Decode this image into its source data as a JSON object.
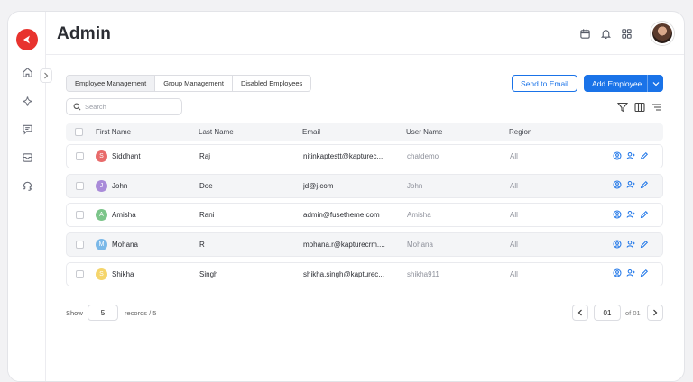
{
  "header": {
    "title": "Admin",
    "icons": [
      "calendar-icon",
      "bell-icon",
      "apps-grid-icon"
    ]
  },
  "sidebar": {
    "items": [
      {
        "name": "home",
        "icon": "home-icon"
      },
      {
        "name": "ai",
        "icon": "sparkle-icon"
      },
      {
        "name": "messages",
        "icon": "chat-icon"
      },
      {
        "name": "inbox",
        "icon": "inbox-icon"
      },
      {
        "name": "support",
        "icon": "headset-icon"
      }
    ]
  },
  "tabs": [
    {
      "label": "Employee Management",
      "active": true
    },
    {
      "label": "Group Management",
      "active": false
    },
    {
      "label": "Disabled Employees",
      "active": false
    }
  ],
  "toolbar": {
    "send_email_label": "Send to Email",
    "add_employee_label": "Add Employee",
    "search_placeholder": "Search"
  },
  "table": {
    "columns": [
      "First Name",
      "Last Name",
      "Email",
      "User Name",
      "Region"
    ],
    "rows": [
      {
        "initial": "S",
        "color": "#e86b6b",
        "first": "Siddhant",
        "last": "Raj",
        "email": "nitinkaptestt@kapturec...",
        "username": "chatdemo",
        "region": "All"
      },
      {
        "initial": "J",
        "color": "#a98bd9",
        "first": "John",
        "last": "Doe",
        "email": "jd@j.com",
        "username": "John",
        "region": "All"
      },
      {
        "initial": "A",
        "color": "#7cc58a",
        "first": "Amisha",
        "last": "Rani",
        "email": "admin@fusetheme.com",
        "username": "Amisha",
        "region": "All"
      },
      {
        "initial": "M",
        "color": "#7ab8e8",
        "first": "Mohana",
        "last": "R",
        "email": "mohana.r@kapturecrm....",
        "username": "Mohana",
        "region": "All"
      },
      {
        "initial": "S",
        "color": "#f5d56b",
        "first": "Shikha",
        "last": "Singh",
        "email": "shikha.singh@kapturec...",
        "username": "shikha911",
        "region": "All"
      }
    ]
  },
  "footer": {
    "show_label": "Show",
    "page_size": "5",
    "records_label": "records / 5",
    "current_page": "01",
    "of_label": "of 01"
  }
}
